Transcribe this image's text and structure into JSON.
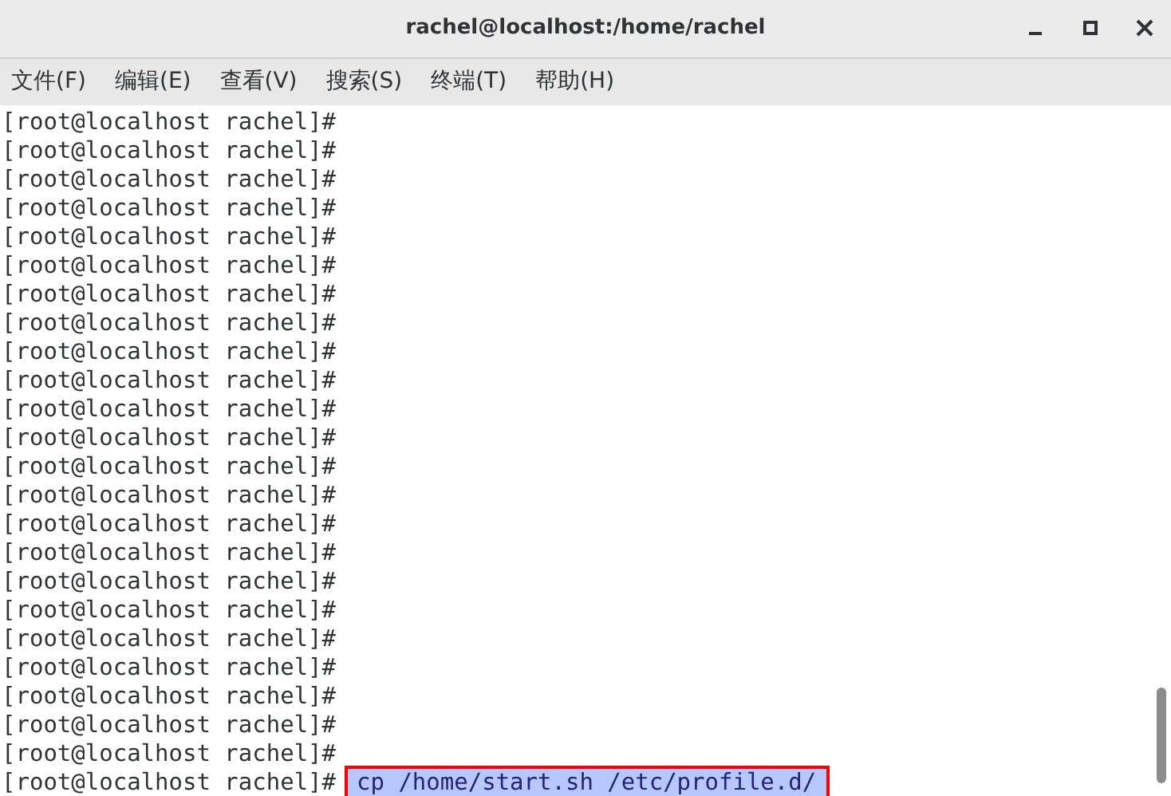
{
  "window": {
    "title": "rachel@localhost:/home/rachel"
  },
  "menu": [
    {
      "label": "文件(F)"
    },
    {
      "label": "编辑(E)"
    },
    {
      "label": "查看(V)"
    },
    {
      "label": "搜索(S)"
    },
    {
      "label": "终端(T)"
    },
    {
      "label": "帮助(H)"
    }
  ],
  "terminal": {
    "lines": [
      {
        "prompt": "[root@localhost rachel]#"
      },
      {
        "prompt": "[root@localhost rachel]#"
      },
      {
        "prompt": "[root@localhost rachel]#"
      },
      {
        "prompt": "[root@localhost rachel]#"
      },
      {
        "prompt": "[root@localhost rachel]#"
      },
      {
        "prompt": "[root@localhost rachel]#"
      },
      {
        "prompt": "[root@localhost rachel]#"
      },
      {
        "prompt": "[root@localhost rachel]#"
      },
      {
        "prompt": "[root@localhost rachel]#"
      },
      {
        "prompt": "[root@localhost rachel]#"
      },
      {
        "prompt": "[root@localhost rachel]#"
      },
      {
        "prompt": "[root@localhost rachel]#"
      },
      {
        "prompt": "[root@localhost rachel]#"
      },
      {
        "prompt": "[root@localhost rachel]#"
      },
      {
        "prompt": "[root@localhost rachel]#"
      },
      {
        "prompt": "[root@localhost rachel]#"
      },
      {
        "prompt": "[root@localhost rachel]#"
      },
      {
        "prompt": "[root@localhost rachel]#"
      },
      {
        "prompt": "[root@localhost rachel]#"
      },
      {
        "prompt": "[root@localhost rachel]#"
      },
      {
        "prompt": "[root@localhost rachel]#"
      },
      {
        "prompt": "[root@localhost rachel]#"
      },
      {
        "prompt": "[root@localhost rachel]#"
      },
      {
        "prompt": "[root@localhost rachel]#",
        "command": "cp /home/start.sh /etc/profile.d/",
        "selected": true
      }
    ]
  }
}
